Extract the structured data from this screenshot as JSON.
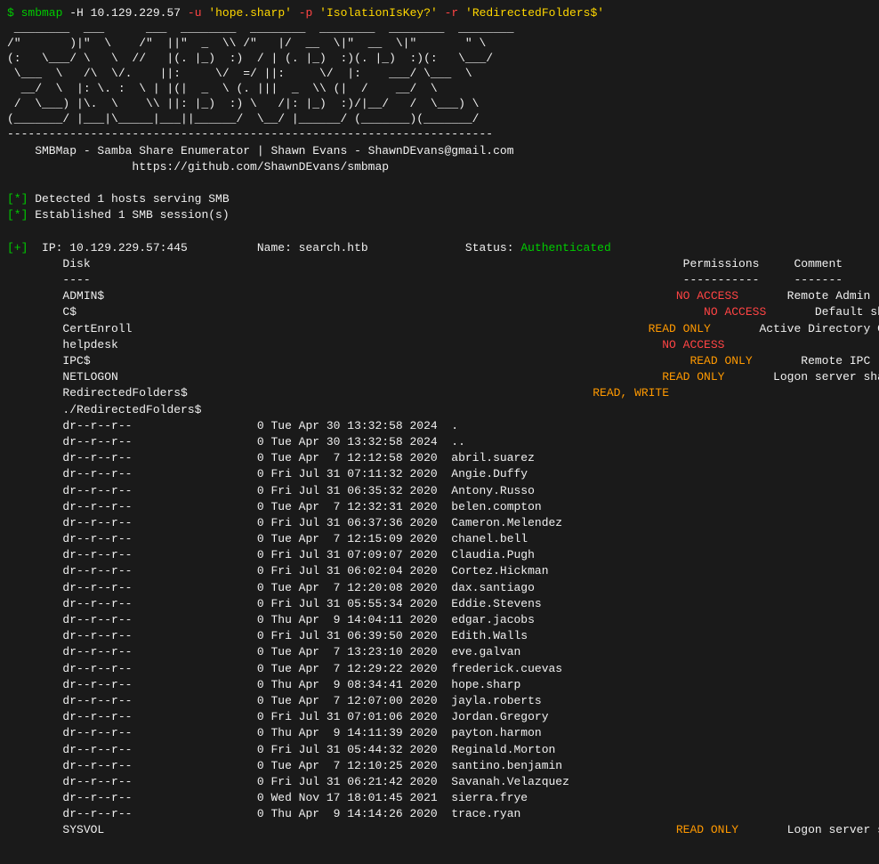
{
  "terminal": {
    "command": {
      "prefix": "$ smbmap",
      "args": "-H 10.129.229.57 -u 'hope.sharp' -p 'IsolationIsKey?' -r 'RedirectedFolders$'"
    },
    "ascii_art": " ________  ___      ___  ________  _____ ______   ________  ________   \n/\"       )|\"  \\    /\"  ||\"  _  \\\\ /\"   |/  __  \\\\|\"  __  \\\\|\"       \" \\\\\n(:   \\___/ \\   \\  //   |(. |_)  :)  / | (. |_)  :)(. |_)  :)(:   \\___/\n \\___  \\   /\\  \\/.    ||:     \\/  =/ ||:     \\/  |:    ___/ \\___  \\    \n  __/  \\  |: \\. :  \\ | |(|  _  \\\\ (. |||  _  \\\\  (|  /    __/  \\   \n /  \\___) |\\.  \\    \\\\ ||: |_)  :) \\   /|: |_)  :)/|__/   /  \\___) \\ \n(_______/ |___|\\_____\\___||______/  \\__/ |______/ (_______)(_______/",
    "divider": "----------------------------------------------------------------------",
    "credit_line1": "    SMBMap - Samba Share Enumerator | Shawn Evans - ShawnDEvans@gmail.com",
    "credit_line2": "              https://github.com/ShawnDEvans/smbmap",
    "detection1": "[*] Detected 1 hosts serving SMB",
    "detection2": "[*] Established 1 SMB session(s)",
    "host_info": {
      "ip": "10.129.229.57:445",
      "name": "search.htb",
      "status_label": "Status:",
      "status_value": "Authenticated"
    },
    "table_headers": {
      "disk": "Disk",
      "permissions": "Permissions",
      "comment": "Comment"
    },
    "shares": [
      {
        "name": "ADMIN$",
        "permissions": "NO ACCESS",
        "comment": "Remote Admin"
      },
      {
        "name": "C$",
        "permissions": "NO ACCESS",
        "comment": "Default share"
      },
      {
        "name": "CertEnroll",
        "permissions": "READ ONLY",
        "comment": "Active Directory Certificate Services share"
      },
      {
        "name": "helpdesk",
        "permissions": "NO ACCESS",
        "comment": ""
      },
      {
        "name": "IPC$",
        "permissions": "READ ONLY",
        "comment": "Remote IPC"
      },
      {
        "name": "NETLOGON",
        "permissions": "READ ONLY",
        "comment": "Logon server share"
      },
      {
        "name": "RedirectedFolders$",
        "permissions": "READ, WRITE",
        "comment": ""
      },
      {
        "name": "./RedirectedFolders$",
        "permissions": "",
        "comment": ""
      }
    ],
    "directory_listing": [
      {
        "perms": "dr--r--r--",
        "size": "0",
        "date": "Tue Apr 30 13:32:58 2024",
        "name": "."
      },
      {
        "perms": "dr--r--r--",
        "size": "0",
        "date": "Tue Apr 30 13:32:58 2024",
        "name": ".."
      },
      {
        "perms": "dr--r--r--",
        "size": "0",
        "date": "Tue Apr  7 12:12:58 2020",
        "name": "abril.suarez"
      },
      {
        "perms": "dr--r--r--",
        "size": "0",
        "date": "Fri Jul 31 07:11:32 2020",
        "name": "Angie.Duffy"
      },
      {
        "perms": "dr--r--r--",
        "size": "0",
        "date": "Fri Jul 31 06:35:32 2020",
        "name": "Antony.Russo"
      },
      {
        "perms": "dr--r--r--",
        "size": "0",
        "date": "Tue Apr  7 12:32:31 2020",
        "name": "belen.compton"
      },
      {
        "perms": "dr--r--r--",
        "size": "0",
        "date": "Fri Jul 31 06:37:36 2020",
        "name": "Cameron.Melendez"
      },
      {
        "perms": "dr--r--r--",
        "size": "0",
        "date": "Tue Apr  7 12:15:09 2020",
        "name": "chanel.bell"
      },
      {
        "perms": "dr--r--r--",
        "size": "0",
        "date": "Fri Jul 31 07:09:07 2020",
        "name": "Claudia.Pugh"
      },
      {
        "perms": "dr--r--r--",
        "size": "0",
        "date": "Fri Jul 31 06:02:04 2020",
        "name": "Cortez.Hickman"
      },
      {
        "perms": "dr--r--r--",
        "size": "0",
        "date": "Tue Apr  7 12:20:08 2020",
        "name": "dax.santiago"
      },
      {
        "perms": "dr--r--r--",
        "size": "0",
        "date": "Fri Jul 31 05:55:34 2020",
        "name": "Eddie.Stevens"
      },
      {
        "perms": "dr--r--r--",
        "size": "0",
        "date": "Thu Apr  9 14:04:11 2020",
        "name": "edgar.jacobs"
      },
      {
        "perms": "dr--r--r--",
        "size": "0",
        "date": "Fri Jul 31 06:39:50 2020",
        "name": "Edith.Walls"
      },
      {
        "perms": "dr--r--r--",
        "size": "0",
        "date": "Tue Apr  7 13:23:10 2020",
        "name": "eve.galvan"
      },
      {
        "perms": "dr--r--r--",
        "size": "0",
        "date": "Tue Apr  7 12:29:22 2020",
        "name": "frederick.cuevas"
      },
      {
        "perms": "dr--r--r--",
        "size": "0",
        "date": "Thu Apr  9 08:34:41 2020",
        "name": "hope.sharp"
      },
      {
        "perms": "dr--r--r--",
        "size": "0",
        "date": "Tue Apr  7 12:07:00 2020",
        "name": "jayla.roberts"
      },
      {
        "perms": "dr--r--r--",
        "size": "0",
        "date": "Fri Jul 31 07:01:06 2020",
        "name": "Jordan.Gregory"
      },
      {
        "perms": "dr--r--r--",
        "size": "0",
        "date": "Thu Apr  9 14:11:39 2020",
        "name": "payton.harmon"
      },
      {
        "perms": "dr--r--r--",
        "size": "0",
        "date": "Fri Jul 31 05:44:32 2020",
        "name": "Reginald.Morton"
      },
      {
        "perms": "dr--r--r--",
        "size": "0",
        "date": "Tue Apr  7 12:10:25 2020",
        "name": "santino.benjamin"
      },
      {
        "perms": "dr--r--r--",
        "size": "0",
        "date": "Fri Jul 31 06:21:42 2020",
        "name": "Savanah.Velazquez"
      },
      {
        "perms": "dr--r--r--",
        "size": "0",
        "date": "Wed Nov 17 18:01:45 2021",
        "name": "sierra.frye"
      },
      {
        "perms": "dr--r--r--",
        "size": "0",
        "date": "Thu Apr  9 14:14:26 2020",
        "name": "trace.ryan"
      }
    ],
    "sysvol": {
      "name": "SYSVOL",
      "permissions": "READ ONLY",
      "comment": "Logon server share"
    }
  }
}
